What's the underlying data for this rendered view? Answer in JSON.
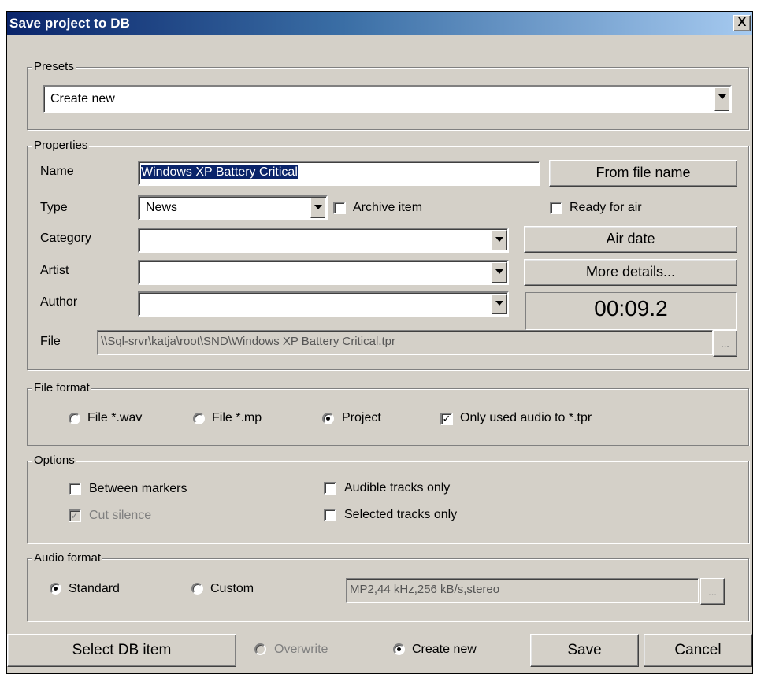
{
  "window": {
    "title": "Save project to DB",
    "close_glyph": "X"
  },
  "presets": {
    "legend": "Presets",
    "selected": "Create new"
  },
  "properties": {
    "legend": "Properties",
    "name_label": "Name",
    "name_value": "Windows XP Battery Critical",
    "from_file_name_label": "From file name",
    "type_label": "Type",
    "type_value": "News",
    "archive_item_label": "Archive item",
    "archive_item_checked": false,
    "ready_for_air_label": "Ready for air",
    "ready_for_air_checked": false,
    "category_label": "Category",
    "category_value": "",
    "air_date_label": "Air date",
    "artist_label": "Artist",
    "artist_value": "",
    "more_details_label": "More details...",
    "author_label": "Author",
    "author_value": "",
    "duration": "00:09.2",
    "file_label": "File",
    "file_value": "\\\\Sql-srvr\\katja\\root\\SND\\Windows XP Battery Critical.tpr",
    "browse_label": "..."
  },
  "file_format": {
    "legend": "File format",
    "options": [
      "File *.wav",
      "File *.mp",
      "Project"
    ],
    "selected": "Project",
    "only_used_audio_label": "Only used audio to *.tpr",
    "only_used_audio_checked": true
  },
  "options": {
    "legend": "Options",
    "between_markers_label": "Between markers",
    "between_markers_checked": false,
    "cut_silence_label": "Cut silence",
    "cut_silence_checked": true,
    "audible_tracks_label": "Audible tracks only",
    "audible_tracks_checked": false,
    "selected_tracks_label": "Selected tracks only",
    "selected_tracks_checked": false
  },
  "audio_format": {
    "legend": "Audio format",
    "standard_label": "Standard",
    "custom_label": "Custom",
    "selected": "Standard",
    "custom_value": "MP2,44 kHz,256 kB/s,stereo",
    "browse_label": "..."
  },
  "bottom": {
    "select_db_item_label": "Select DB item",
    "overwrite_label": "Overwrite",
    "create_new_label": "Create new",
    "save_mode_selected": "Create new",
    "save_label": "Save",
    "cancel_label": "Cancel"
  },
  "colors": {
    "face": "#d4d0c8",
    "title_start": "#0a246a",
    "title_end": "#a6caf0",
    "selection": "#0a246a"
  }
}
